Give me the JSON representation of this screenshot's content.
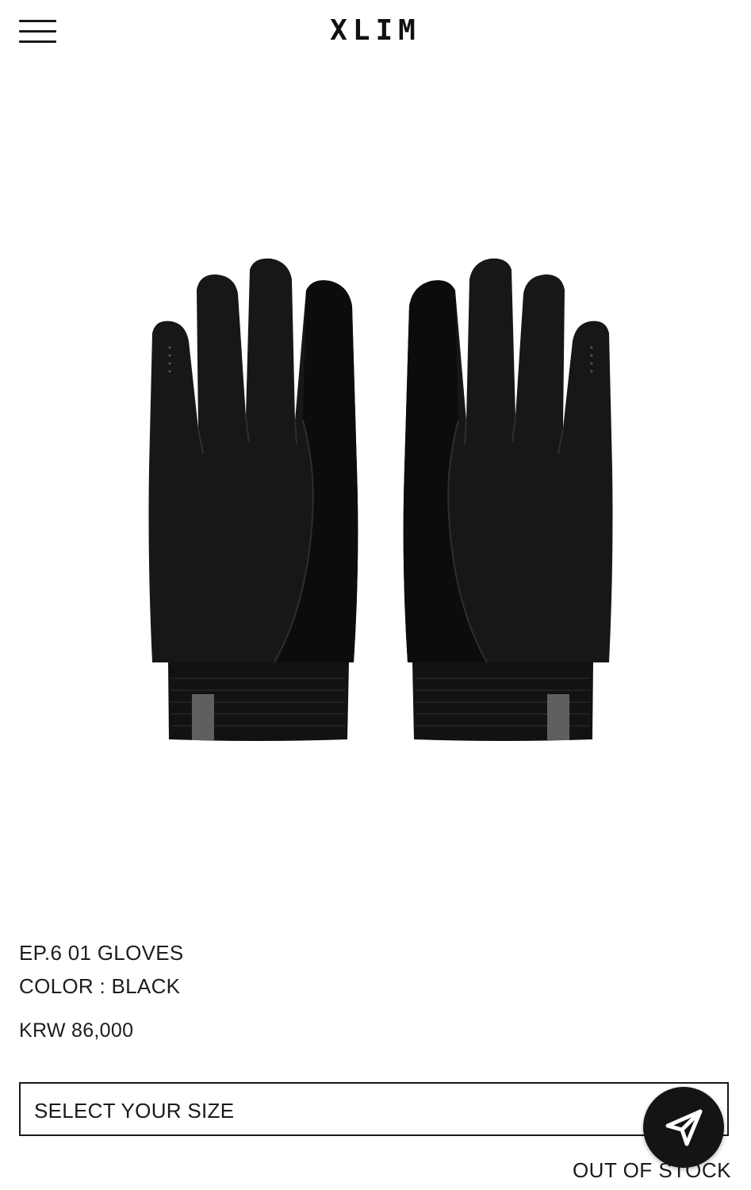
{
  "header": {
    "brand": "XLIM",
    "menu_icon": "hamburger-menu-icon"
  },
  "product": {
    "name": "EP.6 01 GLOVES",
    "color_label": "COLOR : BLACK",
    "price": "KRW 86,000",
    "image": "black-gloves-pair"
  },
  "size_select": {
    "label": "SELECT YOUR SIZE"
  },
  "stock_status": "OUT OF STOCK",
  "floating_button": {
    "icon": "send-arrow-icon"
  },
  "colors": {
    "text": "#1b1b1b",
    "glove": "#161616",
    "tab": "#5f5f5f",
    "fab": "#141414"
  }
}
